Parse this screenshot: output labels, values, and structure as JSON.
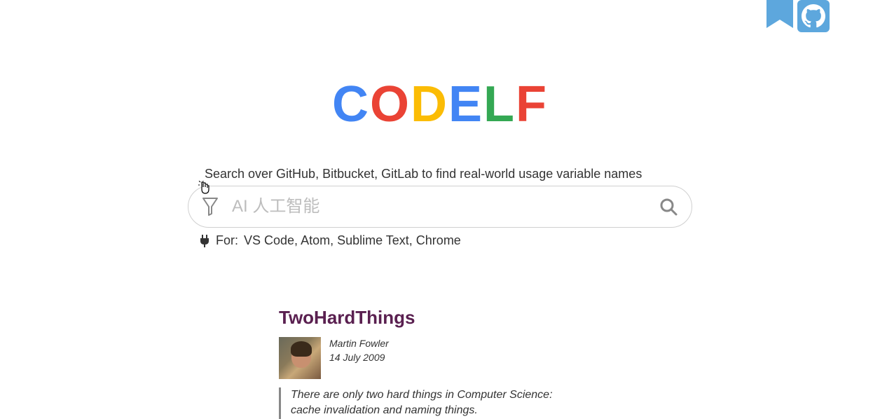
{
  "logo": {
    "letters": [
      "C",
      "O",
      "D",
      "E",
      "L",
      "F"
    ]
  },
  "search": {
    "label": "Search over GitHub, Bitbucket, GitLab to find real-world usage variable names",
    "placeholder": "AI 人工智能",
    "value": ""
  },
  "plugins": {
    "prefix": "For:",
    "items_text": "VS Code, Atom, Sublime Text, Chrome"
  },
  "article": {
    "title": "TwoHardThings",
    "author": "Martin Fowler",
    "date": "14 July 2009",
    "quote_line1": "There are only two hard things in Computer Science:",
    "quote_line2": "cache invalidation and naming things."
  },
  "icons": {
    "bookmark": "bookmark-icon",
    "github": "github-icon",
    "filter": "filter-icon",
    "search": "search-icon",
    "plug": "plug-icon"
  }
}
